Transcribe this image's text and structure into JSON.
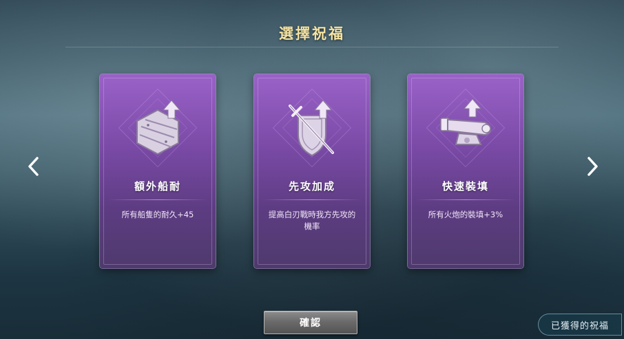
{
  "title": "選擇祝福",
  "cards": [
    {
      "name": "額外船耐",
      "desc": "所有船隻的耐久+45",
      "icon": "ship-plank-upgrade-icon"
    },
    {
      "name": "先攻加成",
      "desc": "提高白刃戰時我方先攻的機率",
      "icon": "sword-shield-upgrade-icon"
    },
    {
      "name": "快速裝填",
      "desc": "所有火炮的裝填+3%",
      "icon": "cannon-upgrade-icon"
    }
  ],
  "confirm_label": "確認",
  "obtained_label": "已獲得的祝福",
  "colors": {
    "title": "#f5e3a2",
    "card_top": "#9a62c8",
    "card_bottom": "#4e3a6c"
  }
}
